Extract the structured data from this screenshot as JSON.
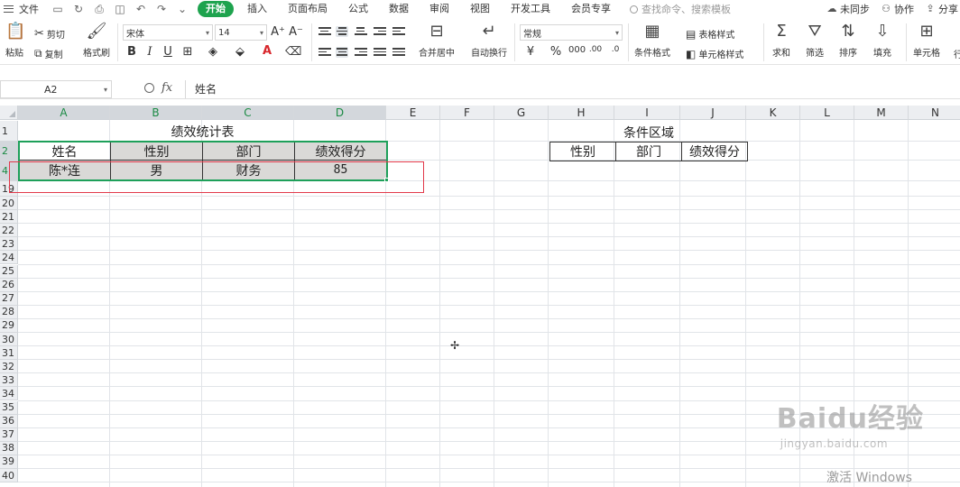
{
  "menubar": {
    "file": "文件",
    "tabs": [
      "开始",
      "插入",
      "页面布局",
      "公式",
      "数据",
      "审阅",
      "视图",
      "开发工具",
      "会员专享"
    ],
    "active_tab": "开始",
    "search_placeholder": "查找命令、搜索模板",
    "sync": "未同步",
    "collab": "协作",
    "share": "分享"
  },
  "ribbon": {
    "paste": "粘贴",
    "cut": "剪切",
    "copy": "复制",
    "format_painter": "格式刷",
    "font_name": "宋体",
    "font_size": "14",
    "merge_center": "合并居中",
    "wrap_text": "自动换行",
    "number_format": "常规",
    "conditional_format": "条件格式",
    "table_style": "表格样式",
    "cell_style": "单元格样式",
    "sum": "求和",
    "filter": "筛选",
    "sort": "排序",
    "fill": "填充",
    "cell": "单元格",
    "extra": "行"
  },
  "formula_bar": {
    "name_box": "A2",
    "fx_label": "fx",
    "value": "姓名"
  },
  "sheet": {
    "columns": [
      "A",
      "B",
      "C",
      "D",
      "E",
      "F",
      "G",
      "H",
      "I",
      "J",
      "K",
      "L",
      "M",
      "N"
    ],
    "rows": [
      "1",
      "2",
      "4",
      "19",
      "20",
      "21",
      "22",
      "23",
      "24",
      "25",
      "26",
      "27",
      "28",
      "29",
      "30",
      "31",
      "32",
      "33",
      "34",
      "35",
      "36",
      "37",
      "38",
      "39",
      "40"
    ],
    "main_title": "绩效统计表",
    "headers": [
      "姓名",
      "性别",
      "部门",
      "绩效得分"
    ],
    "record": [
      "陈*连",
      "男",
      "财务",
      "85"
    ],
    "condition_title": "条件区域",
    "condition_headers": [
      "性别",
      "部门",
      "绩效得分"
    ]
  },
  "watermark": {
    "brand": "Baidu经验",
    "url": "jingyan.baidu.com"
  },
  "activate_text": "激活 Windows"
}
